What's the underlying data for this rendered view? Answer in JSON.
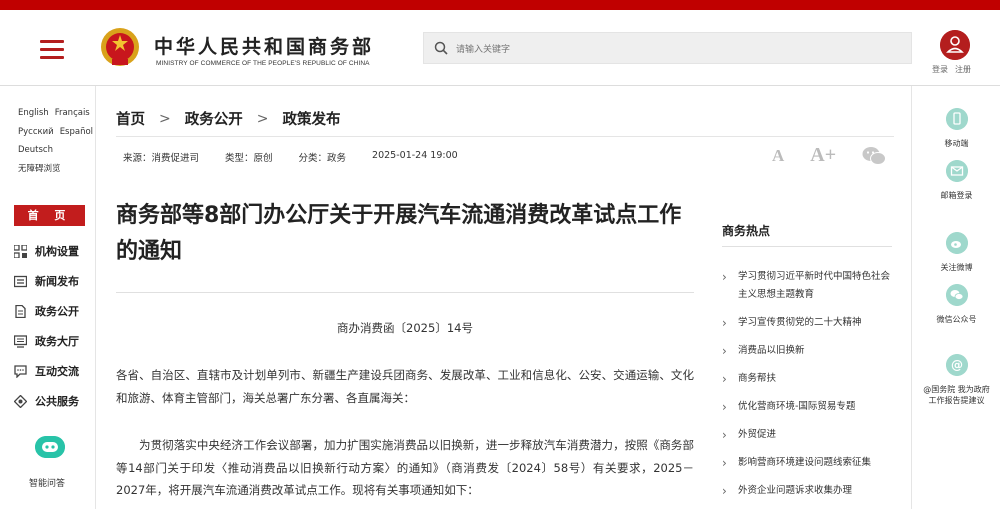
{
  "header": {
    "site_name_cn": "中华人民共和国商务部",
    "site_name_en": "MINISTRY OF COMMERCE OF THE PEOPLE'S REPUBLIC OF CHINA",
    "search_placeholder": "请输入关键字",
    "login": "登录",
    "register": "注册"
  },
  "languages": [
    "English",
    "Français",
    "Русский",
    "Español",
    "Deutsch",
    "无障碍浏览"
  ],
  "left_nav": {
    "home": "首 页",
    "items": [
      {
        "label": "机构设置",
        "icon": "org-grid-icon"
      },
      {
        "label": "新闻发布",
        "icon": "news-icon"
      },
      {
        "label": "政务公开",
        "icon": "document-icon"
      },
      {
        "label": "政务大厅",
        "icon": "hall-monitor-icon"
      },
      {
        "label": "互动交流",
        "icon": "chat-icon"
      },
      {
        "label": "公共服务",
        "icon": "service-icon"
      }
    ],
    "smart_qa": "智能问答"
  },
  "breadcrumb": [
    "首页",
    "政务公开",
    "政策发布"
  ],
  "meta": {
    "source": "来源：消费促进司",
    "type": "类型：原创",
    "category": "分类：政务",
    "datetime": "2025-01-24 19:00"
  },
  "tools": {
    "font_small": "A",
    "font_large": "A+"
  },
  "article": {
    "title": "商务部等8部门办公厅关于开展汽车流通消费改革试点工作的通知",
    "doc_number": "商办消费函〔2025〕14号",
    "p1": "各省、自治区、直辖市及计划单列市、新疆生产建设兵团商务、发展改革、工业和信息化、公安、交通运输、文化和旅游、体育主管部门，海关总署广东分署、各直属海关：",
    "p2": "为贯彻落实中央经济工作会议部署，加力扩围实施消费品以旧换新，进一步释放汽车消费潜力，按照《商务部等14部门关于印发〈推动消费品以旧换新行动方案〉的通知》（商消费发〔2024〕58号）有关要求，2025－2027年，将开展汽车流通消费改革试点工作。现将有关事项通知如下："
  },
  "hot": {
    "title": "商务热点",
    "items": [
      "学习贯彻习近平新时代中国特色社会主义思想主题教育",
      "学习宣传贯彻党的二十大精神",
      "消费品以旧换新",
      "商务帮扶",
      "优化营商环境-国际贸易专题",
      "外贸促进",
      "影响营商环境建设问题线索征集",
      "外资企业问题诉求收集办理"
    ]
  },
  "right_bar": {
    "mobile": "移动端",
    "mail": "邮箱登录",
    "weibo": "关注微博",
    "wechat": "微信公众号",
    "suggest_line1": "@国务院 我为政府",
    "suggest_line2": "工作报告提建议"
  },
  "colors": {
    "brand_red": "#c21d1d",
    "accent_teal": "#28c3a8"
  }
}
